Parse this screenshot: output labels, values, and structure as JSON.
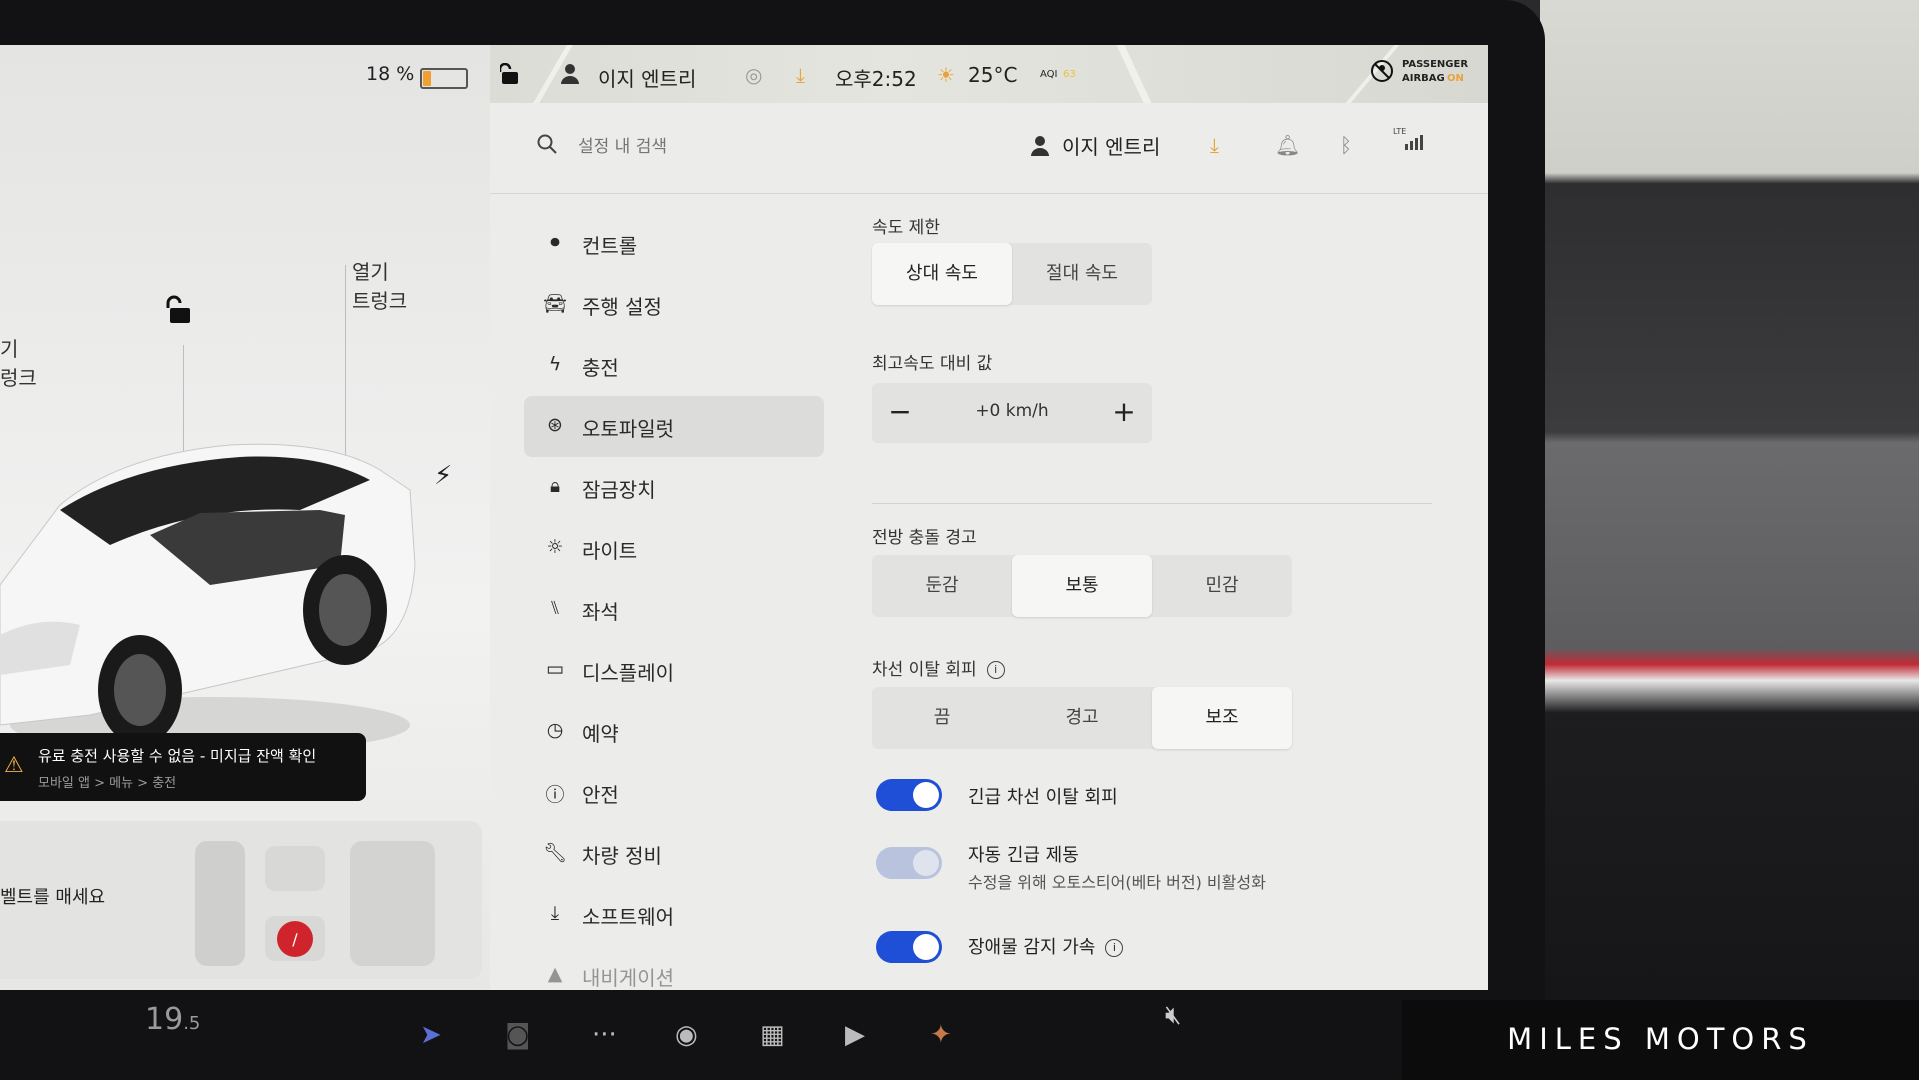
{
  "status": {
    "battery_percent_label": "18 %",
    "battery_level": 0.18,
    "profile_name": "이지 엔트리",
    "time": "오후2:52",
    "temperature": "25°C",
    "aqi_label": "AQI",
    "aqi_value": "63",
    "airbag_line1": "PASSENGER",
    "airbag_line2": "AIRBAG",
    "airbag_state": "ON"
  },
  "car": {
    "trunk_line1": "열기",
    "trunk_line2": "트렁크",
    "frunk_line1": "기",
    "frunk_line2": "렁크",
    "alert_title": "유료 충전 사용할 수 없음 - 미지급 잔액 확인",
    "alert_sub": "모바일 앱 > 메뉴 > 충전",
    "seatbelt_text": "벨트를 매세요"
  },
  "header": {
    "search_placeholder": "설정 내 검색",
    "profile_name": "이지 엔트리",
    "lte_label": "LTE"
  },
  "menu": [
    {
      "label": "컨트롤",
      "icon": "toggle-icon"
    },
    {
      "label": "주행 설정",
      "icon": "car-icon"
    },
    {
      "label": "충전",
      "icon": "bolt-icon"
    },
    {
      "label": "오토파일럿",
      "icon": "steering-wheel-icon"
    },
    {
      "label": "잠금장치",
      "icon": "lock-icon"
    },
    {
      "label": "라이트",
      "icon": "sun-icon"
    },
    {
      "label": "좌석",
      "icon": "seat-icon"
    },
    {
      "label": "디스플레이",
      "icon": "display-icon"
    },
    {
      "label": "예약",
      "icon": "clock-icon"
    },
    {
      "label": "안전",
      "icon": "info-circle-icon"
    },
    {
      "label": "차량 정비",
      "icon": "wrench-icon"
    },
    {
      "label": "소프트웨어",
      "icon": "download-icon"
    },
    {
      "label": "내비게이션",
      "icon": "navigation-icon"
    }
  ],
  "autopilot": {
    "speed_limit_label": "속도 제한",
    "speed_limit_options": [
      "상대 속도",
      "절대 속도"
    ],
    "speed_limit_selected": "상대 속도",
    "offset_label": "최고속도 대비 값",
    "offset_value": "+0 km/h",
    "fcw_label": "전방 충돌 경고",
    "fcw_options": [
      "둔감",
      "보통",
      "민감"
    ],
    "fcw_selected": "보통",
    "lane_label": "차선 이탈 회피",
    "lane_options": [
      "끔",
      "경고",
      "보조"
    ],
    "lane_selected": "보조",
    "emergency_lane_label": "긴급 차선 이탈 회피",
    "emergency_lane_on": true,
    "aeb_label": "자동 긴급 제동",
    "aeb_sub": "수정을 위해 오토스티어(베타 버전) 비활성화",
    "aeb_on": true,
    "obstacle_label": "장애물 감지 가속",
    "obstacle_on": true
  },
  "dock": {
    "temperature": "19",
    "temperature_decimal": ".5"
  },
  "watermark": "MILES MOTORS",
  "colors": {
    "toggle_on": "#1f4fd6",
    "toggle_disabled": "#b9c3dd",
    "alert_icon": "#f1b04c",
    "download_icon": "#e9a23b",
    "accent_red": "#c22a35"
  }
}
